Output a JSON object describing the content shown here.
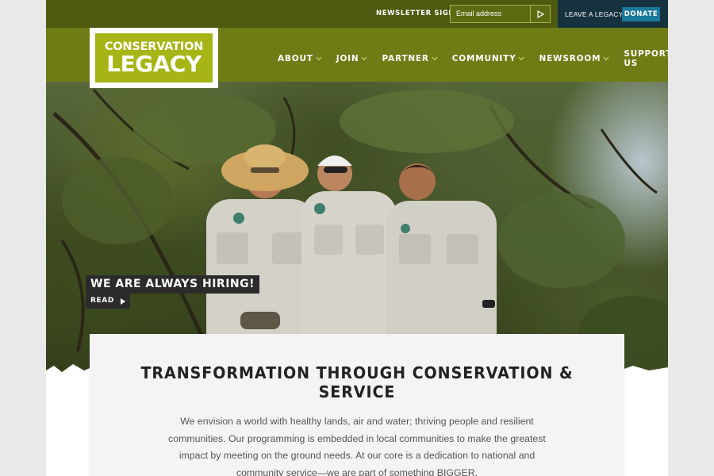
{
  "topbar": {
    "newsletter_label": "NEWSLETTER SIGNUP",
    "email_placeholder": "Email address",
    "submit_icon": "send-arrow-icon",
    "legacy_link": "LEAVE A LEGACY",
    "donate_label": "DONATE"
  },
  "header": {
    "logo_line1": "CONSERVATION",
    "logo_line2": "LEGACY",
    "nav": [
      {
        "label": "ABOUT"
      },
      {
        "label": "JOIN"
      },
      {
        "label": "PARTNER"
      },
      {
        "label": "COMMUNITY"
      },
      {
        "label": "NEWSROOM"
      },
      {
        "label": "SUPPORT US"
      }
    ]
  },
  "hero": {
    "callout": "WE ARE ALWAYS HIRING!",
    "read_label": "READ",
    "read_icon": "play-arrow-icon"
  },
  "intro": {
    "title": "TRANSFORMATION THROUGH CONSERVATION & SERVICE",
    "body": "We envision a world with healthy lands, air and water; thriving people and resilient communities. Our programming is embedded in local communities to make the greatest impact by meeting on the ground needs. At our core is a dedication to national and community service—we are part of something BIGGER."
  },
  "colors": {
    "topbar": "#4e5a0f",
    "header": "#6f7b14",
    "logo_green": "#a6b515",
    "donate": "#19789c",
    "legacy_bg": "#17323f"
  }
}
